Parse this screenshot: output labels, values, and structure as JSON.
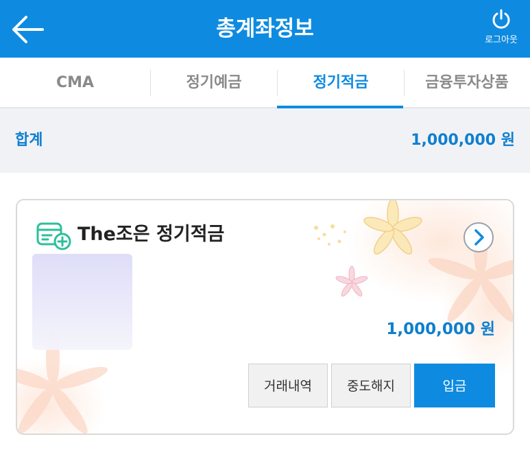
{
  "header": {
    "title": "총계좌정보",
    "logout_label": "로그아웃",
    "back_icon": "arrow-left-icon",
    "logout_icon": "power-icon"
  },
  "tabs": [
    {
      "label": "CMA",
      "active": false
    },
    {
      "label": "정기예금",
      "active": false
    },
    {
      "label": "정기적금",
      "active": true
    },
    {
      "label": "금융투자상품",
      "active": false
    }
  ],
  "summary": {
    "label": "합계",
    "amount": "1,000,000 원"
  },
  "account_card": {
    "product_name": "The조은 정기적금",
    "amount": "1,000,000 원",
    "product_icon": "passbook-plus-icon",
    "detail_icon": "chevron-right-circle-icon",
    "buttons": {
      "history": "거래내역",
      "cancel": "중도해지",
      "deposit": "입금"
    }
  },
  "colors": {
    "primary": "#0e8be0",
    "accent_text": "#0e7fcf",
    "summary_bg": "#f1f2f6",
    "icon_green": "#2bbf9a"
  }
}
